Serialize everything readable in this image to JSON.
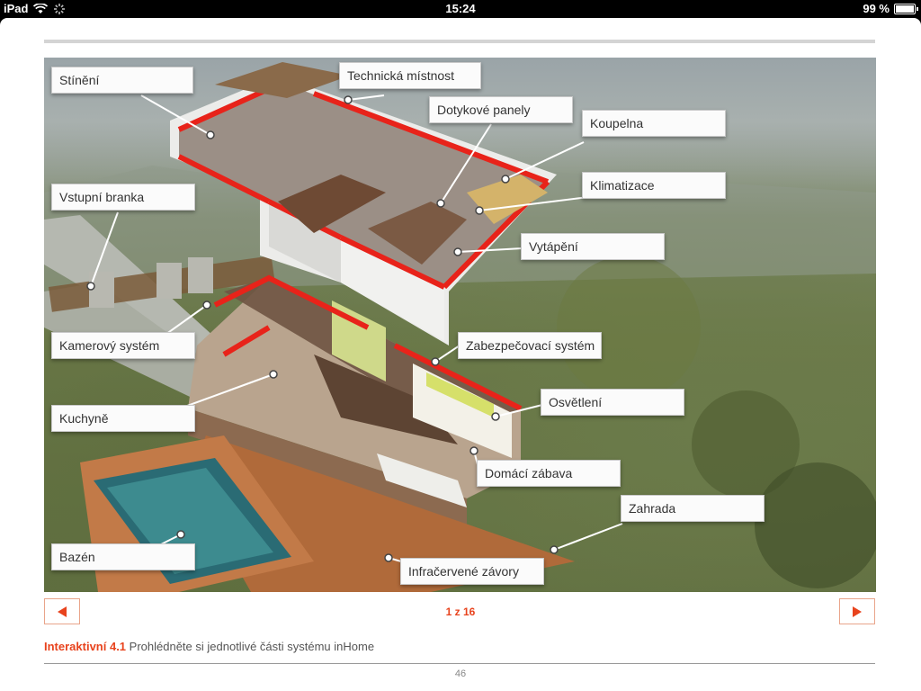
{
  "status_bar": {
    "device": "iPad",
    "time": "15:24",
    "battery": "99 %",
    "battery_level": 0.99
  },
  "callouts": [
    {
      "id": "stineni",
      "label": "Stínění"
    },
    {
      "id": "technicka-mistnost",
      "label": "Technická místnost"
    },
    {
      "id": "dotykove-panely",
      "label": "Dotykové panely"
    },
    {
      "id": "koupelna",
      "label": "Koupelna"
    },
    {
      "id": "vstupni-branka",
      "label": "Vstupní branka"
    },
    {
      "id": "klimatizace",
      "label": "Klimatizace"
    },
    {
      "id": "vytapeni",
      "label": "Vytápění"
    },
    {
      "id": "kamerovy-system",
      "label": "Kamerový systém"
    },
    {
      "id": "zabezpecovaci-system",
      "label": "Zabezpečovací systém"
    },
    {
      "id": "osvetleni",
      "label": "Osvětlení"
    },
    {
      "id": "kuchyne",
      "label": "Kuchyně"
    },
    {
      "id": "domaci-zabava",
      "label": "Domácí zábava"
    },
    {
      "id": "zahrada",
      "label": "Zahrada"
    },
    {
      "id": "bazen",
      "label": "Bazén"
    },
    {
      "id": "infracervene-zavory",
      "label": "Infračervené závory"
    }
  ],
  "pager": {
    "text": "1 z 16"
  },
  "caption": {
    "label": "Interaktivní 4.1",
    "text": " Prohlédněte si jednotlivé části systému inHome"
  },
  "page_number": "46",
  "colors": {
    "accent": "#e8431d"
  }
}
